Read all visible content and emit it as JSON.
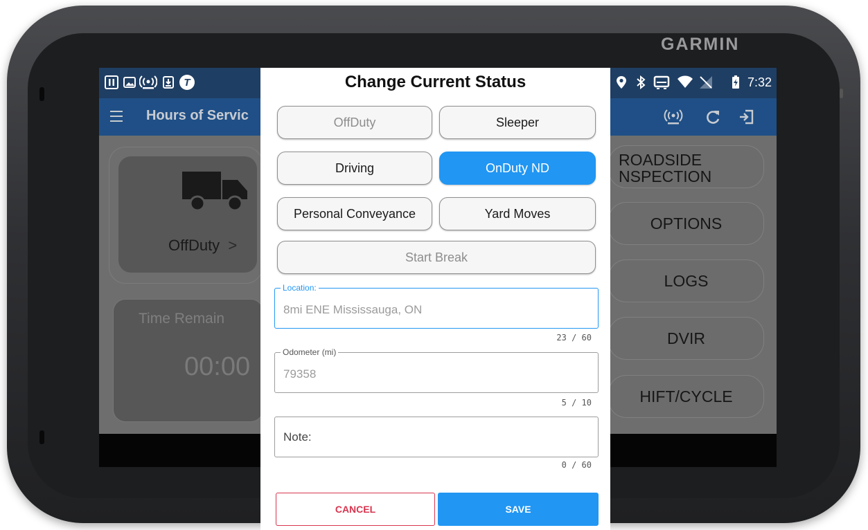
{
  "device": {
    "brand": "GARMIN"
  },
  "status_bar": {
    "left_icons": [
      "pause-icon",
      "image-icon",
      "broadcast-icon",
      "download-icon",
      "t-circle-icon"
    ],
    "right_icons": [
      "location-icon",
      "bluetooth-icon",
      "cast-icon",
      "wifi-icon",
      "no-signal-icon",
      "battery-charging-icon"
    ],
    "time": "7:32"
  },
  "app_bar": {
    "title": "Hours of Servic",
    "actions": [
      "broadcast-icon",
      "refresh-icon",
      "logout-icon"
    ]
  },
  "background": {
    "status_label": "OffDuty",
    "status_chevron": ">",
    "time_remaining_label": "Time Remain",
    "time_remaining_value": "00:00",
    "side_buttons": {
      "roadside_line1": "ROADSIDE",
      "roadside_line2": "NSPECTION",
      "options": "OPTIONS",
      "logs": "LOGS",
      "dvir": "DVIR",
      "shift_cycle": "HIFT/CYCLE"
    }
  },
  "dialog": {
    "title": "Change Current Status",
    "status_options": {
      "offduty": "OffDuty",
      "sleeper": "Sleeper",
      "driving": "Driving",
      "onduty_nd": "OnDuty ND",
      "personal_conveyance": "Personal Conveyance",
      "yard_moves": "Yard Moves",
      "start_break": "Start Break"
    },
    "selected_status": "OnDuty ND",
    "location": {
      "label": "Location:",
      "value": "8mi ENE Mississauga, ON",
      "counter": "23 / 60"
    },
    "odometer": {
      "label": "Odometer (mi)",
      "value": "79358",
      "counter": "5 / 10"
    },
    "note": {
      "placeholder": "Note:",
      "counter": "0 / 60"
    },
    "cancel_label": "CANCEL",
    "save_label": "SAVE"
  },
  "colors": {
    "accent": "#2196F3",
    "cancel": "#D8354F",
    "app_bar": "#1F4F86",
    "status_bar": "#1F3E63"
  }
}
